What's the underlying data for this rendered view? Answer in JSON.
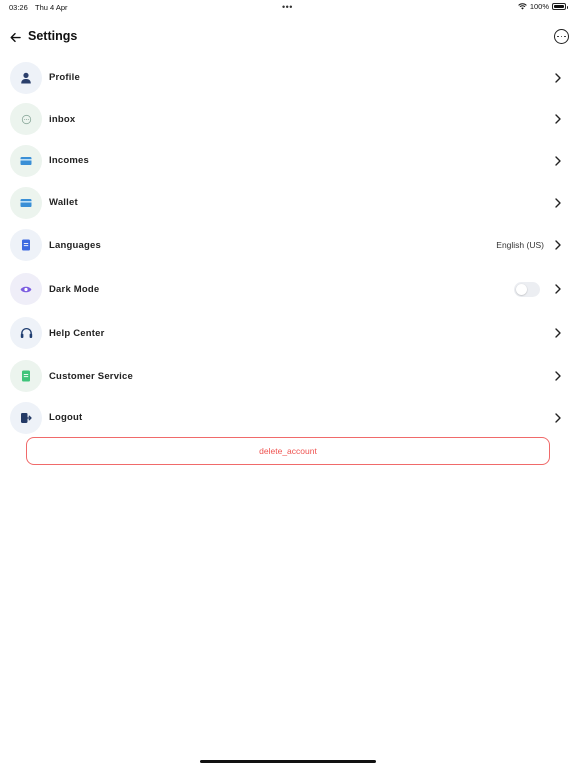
{
  "status_bar": {
    "time": "03:26",
    "date": "Thu 4 Apr",
    "battery": "100%"
  },
  "header": {
    "title": "Settings"
  },
  "menu": {
    "items": [
      {
        "label": "Profile",
        "icon": "person-icon",
        "icon_color": "#2b3f6b"
      },
      {
        "label": "inbox",
        "icon": "chat-bubble-icon",
        "icon_color": "#8aa89a"
      },
      {
        "label": "Incomes",
        "icon": "card-icon",
        "icon_color": "#3a8fd6"
      },
      {
        "label": "Wallet",
        "icon": "card-icon",
        "icon_color": "#3a8fd6"
      },
      {
        "label": "Languages",
        "icon": "document-icon",
        "icon_color": "#3e6be0",
        "value": "English (US)"
      },
      {
        "label": "Dark Mode",
        "icon": "eye-icon",
        "icon_color": "#7b5ce0",
        "toggle": false
      },
      {
        "label": "Help Center",
        "icon": "headset-icon",
        "icon_color": "#1f3d70"
      },
      {
        "label": "Customer Service",
        "icon": "document-icon",
        "icon_color": "#3fc47a"
      },
      {
        "label": "Logout",
        "icon": "logout-icon",
        "icon_color": "#243a66"
      }
    ]
  },
  "delete_button": {
    "label": "delete_account",
    "color": "#ef5350"
  }
}
